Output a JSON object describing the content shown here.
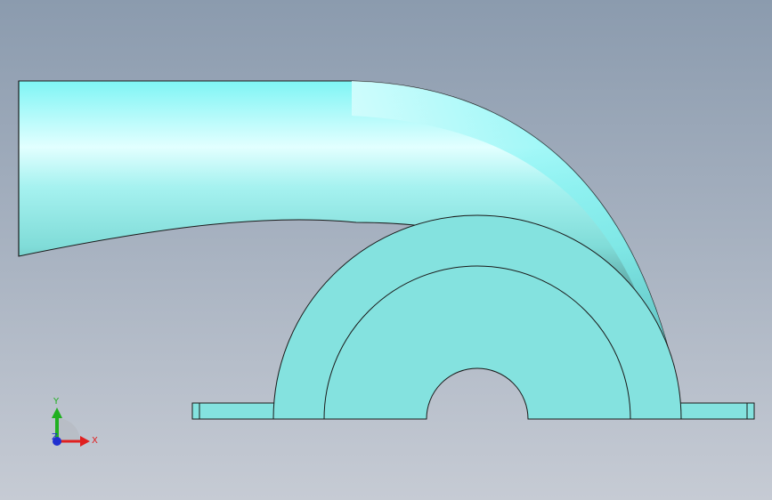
{
  "viewport": {
    "background_top": "#8b9bae",
    "background_bottom": "#c6cbd4"
  },
  "model": {
    "face_color": "#84e2df",
    "highlight_color": "#e6ffff",
    "shadow_color": "#2f5556",
    "edge_color": "#1a1a1a"
  },
  "triad": {
    "x_label": "X",
    "y_label": "Y",
    "z_label": "Z",
    "x_color": "#e02020",
    "y_color": "#20b020",
    "z_color": "#2030d0"
  }
}
